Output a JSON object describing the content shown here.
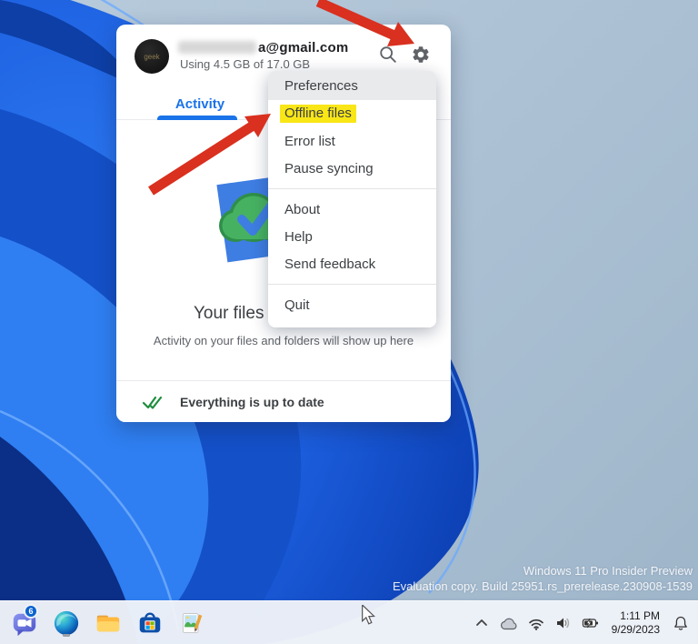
{
  "colors": {
    "accent_blue": "#1a73e8",
    "highlight_yellow": "#f9e617",
    "arrow_red": "#d9301f",
    "check_green": "#1e8e3e"
  },
  "drive_popup": {
    "account": {
      "avatar_text": "geek",
      "email_suffix": "a@gmail.com",
      "storage": "Using 4.5 GB of 17.0 GB"
    },
    "tabs": {
      "activity": "Activity"
    },
    "empty_state": {
      "title_visible": "Your files a",
      "caption": "Activity on your files and folders will show up here"
    },
    "status_bar": {
      "message": "Everything is up to date"
    }
  },
  "settings_menu": {
    "items": [
      "Preferences",
      "Offline files",
      "Error list",
      "Pause syncing",
      "About",
      "Help",
      "Send feedback",
      "Quit"
    ],
    "highlighted_item": "Offline files",
    "hovered_item": "Preferences"
  },
  "desktop": {
    "watermark_line1": "Windows 11 Pro Insider Preview",
    "watermark_line2": "Evaluation copy. Build 25951.rs_prerelease.230908-1539"
  },
  "taskbar": {
    "teams_badge": "6",
    "clock_time": "1:11 PM",
    "clock_date": "9/29/2023"
  }
}
